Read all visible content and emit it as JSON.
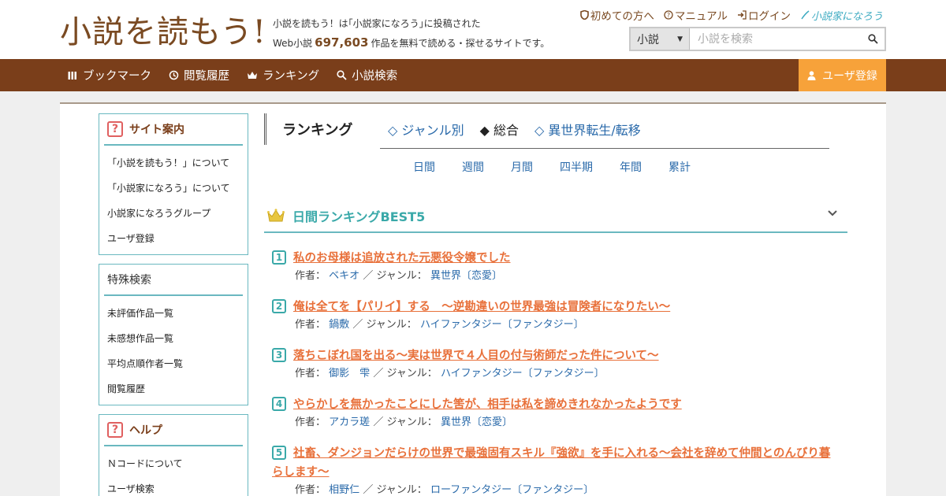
{
  "header": {
    "logo_text": "小説を読もう!",
    "tagline_1": "小説を読もう！は｢小説家になろう｣に投稿された",
    "tagline_2_prefix": "Web小説",
    "work_count": "697,603",
    "tagline_2_suffix": "作品を無料で読める・探せるサイトです。",
    "links": {
      "beginner": "初めての方へ",
      "manual": "マニュアル",
      "login": "ログイン",
      "brand": "小説家になろう"
    },
    "search": {
      "category": "小説",
      "placeholder": "小説を検索"
    }
  },
  "nav": {
    "bookmark": "ブックマーク",
    "history": "閲覧履歴",
    "ranking": "ランキング",
    "search": "小説検索",
    "register": "ユーザ登録"
  },
  "sidebar": {
    "site_guide": {
      "title": "サイト案内",
      "items": [
        "「小説を読もう！」について",
        "「小説家になろう」について",
        "小説家になろうグループ",
        "ユーザ登録"
      ]
    },
    "special_search": {
      "title": "特殊検索",
      "items": [
        "未評価作品一覧",
        "未感想作品一覧",
        "平均点順作者一覧",
        "閲覧履歴"
      ]
    },
    "help": {
      "title": "ヘルプ",
      "items": [
        "Ｎコードについて",
        "ユーザ検索"
      ]
    }
  },
  "ranking": {
    "title": "ランキング",
    "tabs": [
      "◇ ジャンル別",
      "◆ 総合",
      "◇ 異世界転生/転移"
    ],
    "periods": [
      "日間",
      "週間",
      "月間",
      "四半期",
      "年間",
      "累計"
    ],
    "best_title": "日間ランキングBEST5",
    "author_label": "作者：",
    "genre_label": "／ ジャンル：",
    "entries": [
      {
        "rank": "1",
        "title": "私のお母様は追放された元悪役令嬢でした",
        "author": "ベキオ",
        "genre": "異世界〔恋愛〕"
      },
      {
        "rank": "2",
        "title": "俺は全てを【パリイ】する　〜逆勘違いの世界最強は冒険者になりたい〜",
        "author": "鍋敷",
        "genre": "ハイファンタジー〔ファンタジー〕"
      },
      {
        "rank": "3",
        "title": "落ちこぼれ国を出る〜実は世界で４人目の付与術師だった件について〜",
        "author": "御影　雫",
        "genre": "ハイファンタジー〔ファンタジー〕"
      },
      {
        "rank": "4",
        "title": "やらかしを無かったことにした筈が、相手は私を諦めきれなかったようです",
        "author": "アカラ瑳",
        "genre": "異世界〔恋愛〕"
      },
      {
        "rank": "5",
        "title": "社畜、ダンジョンだらけの世界で最強固有スキル『強欲』を手に入れる～会社を辞めて仲間とのんびり暮らします～",
        "author": "相野仁",
        "genre": "ローファンタジー〔ファンタジー〕"
      }
    ]
  },
  "colors": {
    "brand_brown": "#7a3e1a",
    "register_orange": "#f7a23a",
    "accent_teal": "#3aa9a9",
    "title_orange": "#e8703a",
    "link_blue": "#2a6aaa"
  },
  "icons": {
    "nav_bookmark": "bookmark-icon",
    "nav_history": "history-icon",
    "nav_ranking": "crown-icon",
    "nav_search": "search-icon",
    "register": "user-icon",
    "help": "question-icon"
  }
}
